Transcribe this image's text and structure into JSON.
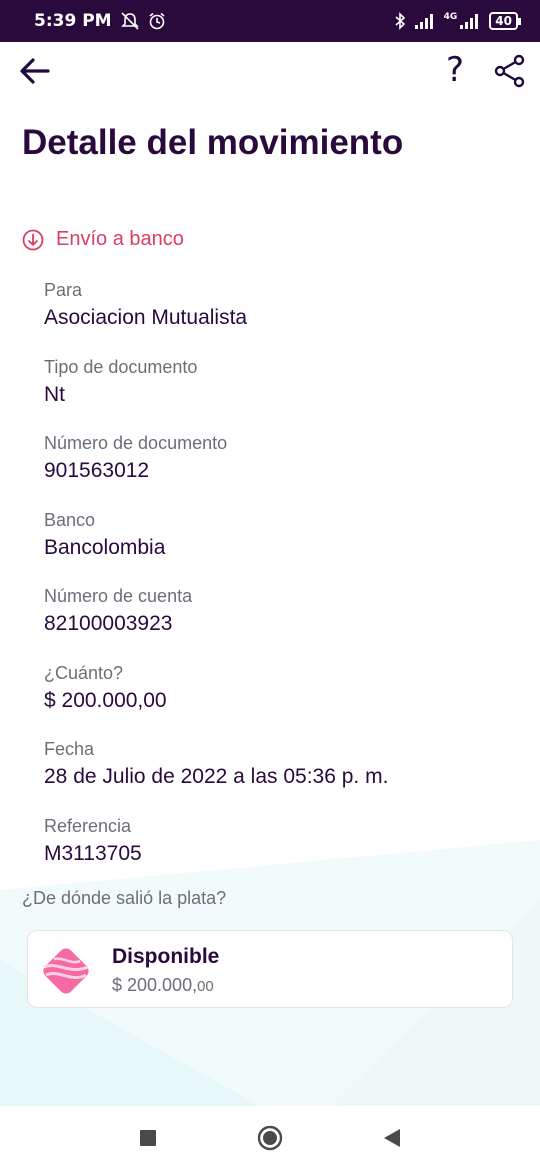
{
  "status_bar": {
    "time": "5:39 PM",
    "battery": "40",
    "network": "4G"
  },
  "header": {
    "help_label": "?"
  },
  "page_title": "Detalle del movimiento",
  "movement_type": "Envío a banco",
  "details": [
    {
      "label": "Para",
      "value": "Asociacion Mutualista"
    },
    {
      "label": "Tipo de documento",
      "value": "Nt"
    },
    {
      "label": "Número de documento",
      "value": "901563012"
    },
    {
      "label": "Banco",
      "value": "Bancolombia"
    },
    {
      "label": "Número de cuenta",
      "value": "82100003923"
    },
    {
      "label": "¿Cuánto?",
      "value": "$ 200.000,00"
    },
    {
      "label": "Fecha",
      "value": "28 de Julio de 2022 a las 05:36 p. m."
    },
    {
      "label": "Referencia",
      "value": "M3113705"
    }
  ],
  "source": {
    "question": "¿De dónde salió la plata?",
    "name": "Disponible",
    "amount_main": "$ 200.000,",
    "amount_cents": "00"
  },
  "colors": {
    "primary": "#2a0a3d",
    "accent": "#dc3d63",
    "muted": "#6e6e78",
    "card_icon": "#f56aa3"
  },
  "icons": [
    "back-arrow-icon",
    "help-icon",
    "share-icon",
    "arrow-down-circle-icon",
    "wallet-icon",
    "recent-apps-icon",
    "home-icon",
    "back-icon"
  ]
}
